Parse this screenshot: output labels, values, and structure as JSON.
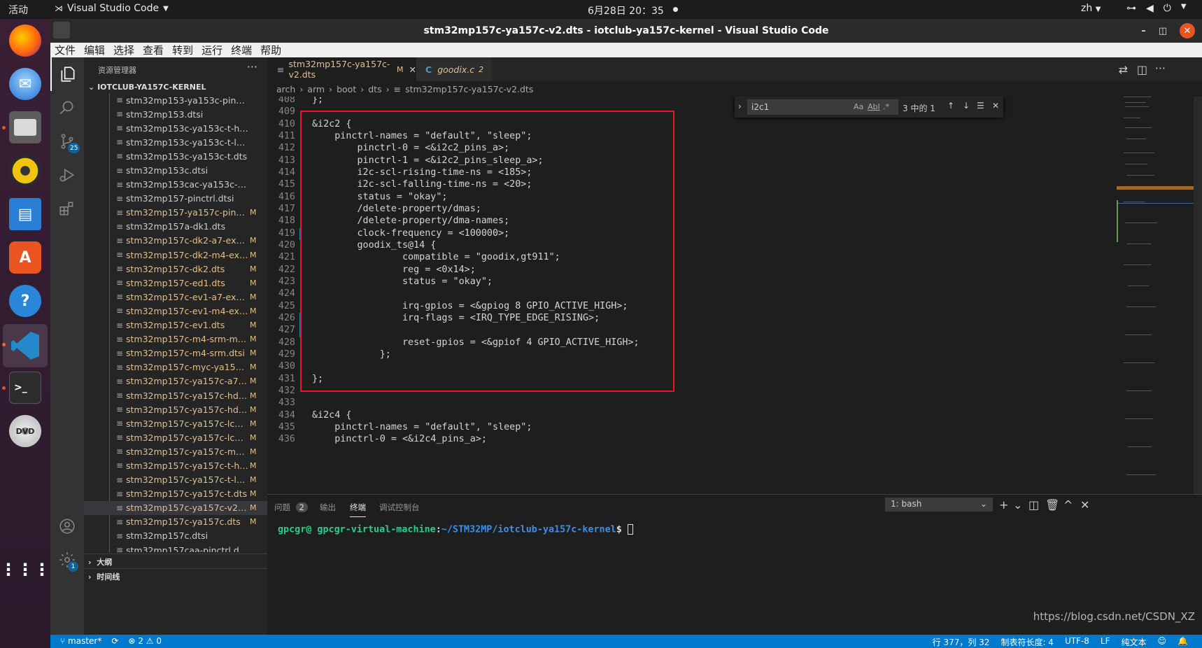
{
  "topbar": {
    "activities": "活动",
    "app_name": "Visual Studio Code",
    "clock": "6月28日 20：35",
    "lang": "zh"
  },
  "window": {
    "title": "stm32mp157c-ya157c-v2.dts - iotclub-ya157c-kernel - Visual Studio Code"
  },
  "menu": [
    "文件",
    "编辑",
    "选择",
    "查看",
    "转到",
    "运行",
    "终端",
    "帮助"
  ],
  "sidebar": {
    "header": "资源管理器",
    "project": "IOTCLUB-YA157C-KERNEL",
    "files": [
      {
        "name": "stm32mp153-ya153c-pinctrl.dtsi",
        "status": ""
      },
      {
        "name": "stm32mp153.dtsi",
        "status": ""
      },
      {
        "name": "stm32mp153c-ya153c-t-hdmi.dts",
        "status": ""
      },
      {
        "name": "stm32mp153c-ya153c-t-lcd.dts",
        "status": ""
      },
      {
        "name": "stm32mp153c-ya153c-t.dts",
        "status": ""
      },
      {
        "name": "stm32mp153c.dtsi",
        "status": ""
      },
      {
        "name": "stm32mp153cac-ya153c-pinctrl.dtsi",
        "status": ""
      },
      {
        "name": "stm32mp157-pinctrl.dtsi",
        "status": ""
      },
      {
        "name": "stm32mp157-ya157c-pinctrl.d...",
        "status": "M"
      },
      {
        "name": "stm32mp157a-dk1.dts",
        "status": ""
      },
      {
        "name": "stm32mp157c-dk2-a7-exampl...",
        "status": "M"
      },
      {
        "name": "stm32mp157c-dk2-m4-examp...",
        "status": "M"
      },
      {
        "name": "stm32mp157c-dk2.dts",
        "status": "M"
      },
      {
        "name": "stm32mp157c-ed1.dts",
        "status": "M"
      },
      {
        "name": "stm32mp157c-ev1-a7-exampl...",
        "status": "M"
      },
      {
        "name": "stm32mp157c-ev1-m4-examp...",
        "status": "M"
      },
      {
        "name": "stm32mp157c-ev1.dts",
        "status": "M"
      },
      {
        "name": "stm32mp157c-m4-srm-myir.dtsi",
        "status": "M"
      },
      {
        "name": "stm32mp157c-m4-srm.dtsi",
        "status": "M"
      },
      {
        "name": "stm32mp157c-myc-ya157c.dtsi",
        "status": "M"
      },
      {
        "name": "stm32mp157c-ya157c-a7-exa...",
        "status": "M"
      },
      {
        "name": "stm32mp157c-ya157c-hdmi-v...",
        "status": "M"
      },
      {
        "name": "stm32mp157c-ya157c-hdmi.dts",
        "status": "M"
      },
      {
        "name": "stm32mp157c-ya157c-lcd-v2....",
        "status": "M"
      },
      {
        "name": "stm32mp157c-ya157c-lcd.dts",
        "status": "M"
      },
      {
        "name": "stm32mp157c-ya157c-m4-exa...",
        "status": "M"
      },
      {
        "name": "stm32mp157c-ya157c-t-hdmi....",
        "status": "M"
      },
      {
        "name": "stm32mp157c-ya157c-t-lcd.dts",
        "status": "M"
      },
      {
        "name": "stm32mp157c-ya157c-t.dts",
        "status": "M"
      },
      {
        "name": "stm32mp157c-ya157c-v2.dts",
        "status": "M"
      },
      {
        "name": "stm32mp157c-ya157c.dts",
        "status": "M"
      },
      {
        "name": "stm32mp157c.dtsi",
        "status": ""
      },
      {
        "name": "stm32mp157caa-pinctrl.dtsi",
        "status": ""
      }
    ],
    "outline": "大纲",
    "timeline": "时间线"
  },
  "activity": {
    "scm_badge": "25",
    "settings_badge": "1"
  },
  "tabs": [
    {
      "label": "stm32mp157c-ya157c-v2.dts",
      "status": "M"
    },
    {
      "label": "goodix.c",
      "status": "2"
    }
  ],
  "breadcrumb": [
    "arch",
    "arm",
    "boot",
    "dts",
    "stm32mp157c-ya157c-v2.dts"
  ],
  "find": {
    "value": "i2c1",
    "opt_case": "Aa",
    "opt_word": "Abl",
    "opt_regex": ".*",
    "count": "3 中的 1"
  },
  "code": [
    {
      "n": "408",
      "t": "};"
    },
    {
      "n": "409",
      "t": ""
    },
    {
      "n": "410",
      "t": "&i2c2 {"
    },
    {
      "n": "411",
      "t": "    pinctrl-names = \"default\", \"sleep\";"
    },
    {
      "n": "412",
      "t": "        pinctrl-0 = <&i2c2_pins_a>;"
    },
    {
      "n": "413",
      "t": "        pinctrl-1 = <&i2c2_pins_sleep_a>;"
    },
    {
      "n": "414",
      "t": "        i2c-scl-rising-time-ns = <185>;"
    },
    {
      "n": "415",
      "t": "        i2c-scl-falling-time-ns = <20>;"
    },
    {
      "n": "416",
      "t": "        status = \"okay\";"
    },
    {
      "n": "417",
      "t": "        /delete-property/dmas;"
    },
    {
      "n": "418",
      "t": "        /delete-property/dma-names;"
    },
    {
      "n": "419",
      "t": "        clock-frequency = <100000>;"
    },
    {
      "n": "420",
      "t": "        goodix_ts@14 {"
    },
    {
      "n": "421",
      "t": "                compatible = \"goodix,gt911\";"
    },
    {
      "n": "422",
      "t": "                reg = <0x14>;"
    },
    {
      "n": "423",
      "t": "                status = \"okay\";"
    },
    {
      "n": "424",
      "t": ""
    },
    {
      "n": "425",
      "t": "                irq-gpios = <&gpiog 8 GPIO_ACTIVE_HIGH>;"
    },
    {
      "n": "426",
      "t": "                irq-flags = <IRQ_TYPE_EDGE_RISING>;"
    },
    {
      "n": "427",
      "t": ""
    },
    {
      "n": "428",
      "t": "                reset-gpios = <&gpiof 4 GPIO_ACTIVE_HIGH>;"
    },
    {
      "n": "429",
      "t": "            };"
    },
    {
      "n": "430",
      "t": ""
    },
    {
      "n": "431",
      "t": "};"
    },
    {
      "n": "432",
      "t": ""
    },
    {
      "n": "433",
      "t": ""
    },
    {
      "n": "434",
      "t": "&i2c4 {"
    },
    {
      "n": "435",
      "t": "    pinctrl-names = \"default\", \"sleep\";"
    },
    {
      "n": "436",
      "t": "    pinctrl-0 = <&i2c4_pins_a>;"
    }
  ],
  "panel": {
    "tabs": [
      "问题",
      "输出",
      "终端",
      "调试控制台"
    ],
    "problems_count": "2",
    "terminal_select": "1: bash",
    "prompt_user": "gpcgr@ gpcgr-virtual-machine",
    "prompt_sep": ":",
    "prompt_path": "~/STM32MP/iotclub-ya157c-kernel",
    "prompt_end": "$ "
  },
  "status": {
    "branch": "master*",
    "errors": "2",
    "warnings": "0",
    "position": "行 377，列 32",
    "indent": "制表符长度: 4",
    "encoding": "UTF-8",
    "eol": "LF",
    "lang": "纯文本"
  },
  "watermark": "https://blog.csdn.net/CSDN_XZ"
}
